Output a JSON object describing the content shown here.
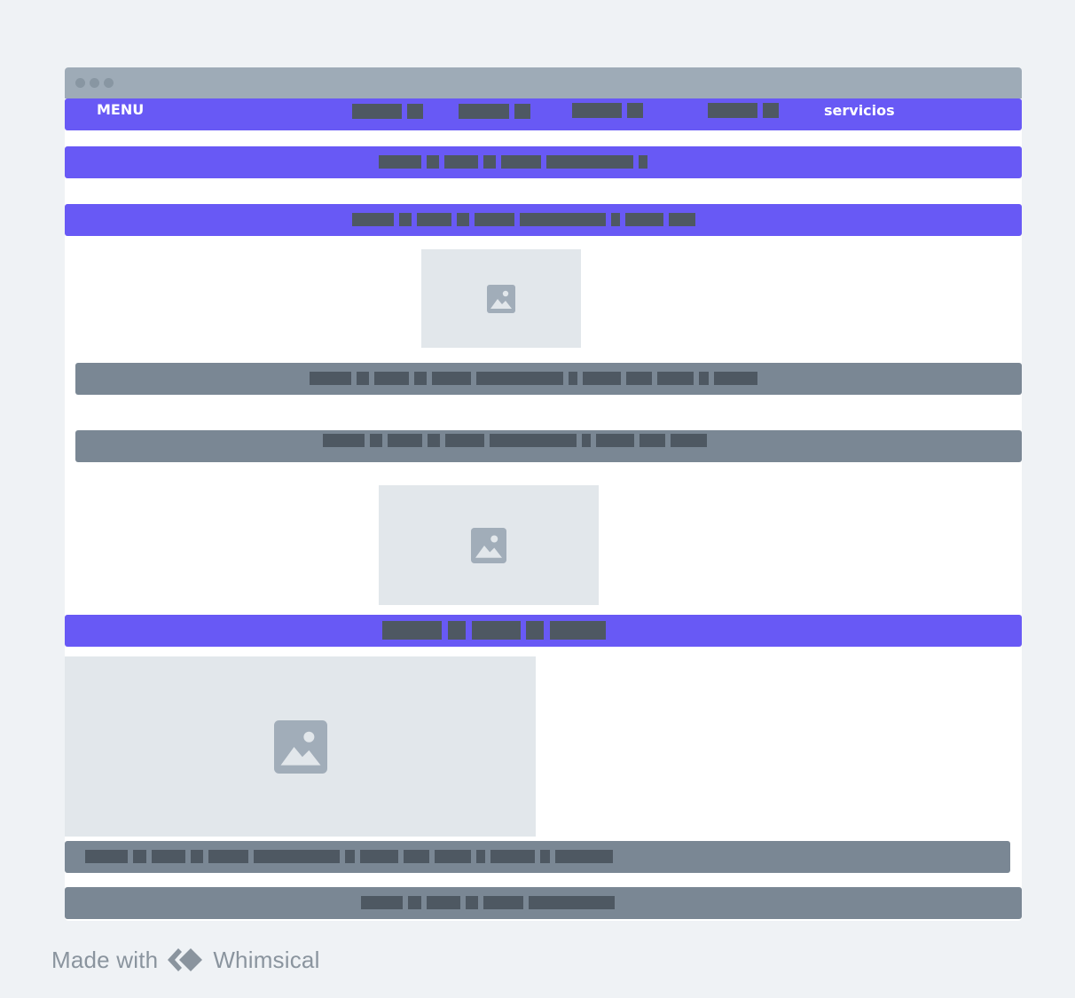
{
  "navbar": {
    "menu_label": "MENU",
    "servicios_label": "servicios"
  },
  "footer": {
    "made_with": "Made with",
    "brand_name": "Whimsical"
  },
  "colors": {
    "accent": "#6859f5",
    "gray_bar": "#7a8794",
    "placeholder_block": "#4e5862",
    "image_placeholder": "#e2e7eb",
    "page_background": "#eff2f5"
  },
  "icons": [
    "image-icon",
    "whimsical-logo-icon"
  ]
}
